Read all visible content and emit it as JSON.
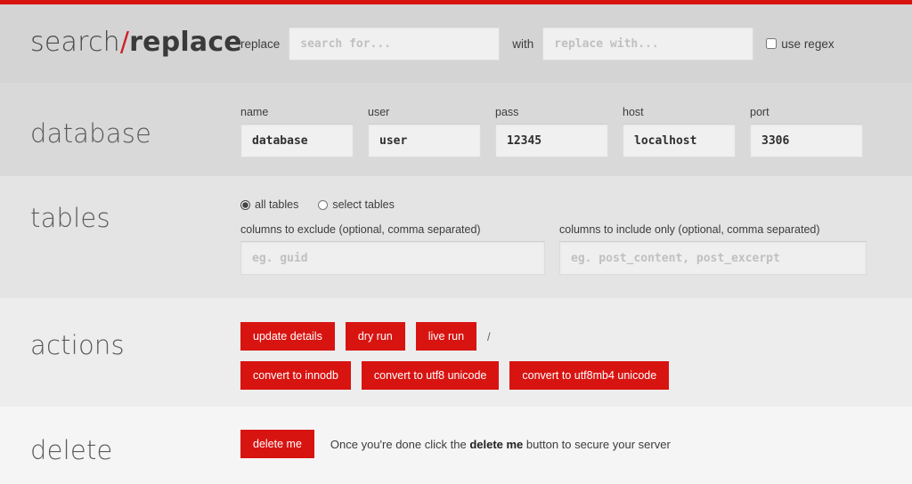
{
  "theme": {
    "accent_red": "#d81411",
    "topbar_red": "#d81411",
    "text_dark": "#3c3c3c"
  },
  "header": {
    "title_part1": "search",
    "title_slash": "/",
    "title_part2": "replace",
    "replace_label": "replace",
    "search_for_placeholder": "search for...",
    "search_for_value": "",
    "with_label": "with",
    "replace_with_placeholder": "replace with...",
    "replace_with_value": "",
    "use_regex_label": "use regex",
    "use_regex_checked": false
  },
  "database": {
    "title": "database",
    "fields": [
      {
        "label": "name",
        "value": "database"
      },
      {
        "label": "user",
        "value": "user"
      },
      {
        "label": "pass",
        "value": "12345"
      },
      {
        "label": "host",
        "value": "localhost"
      },
      {
        "label": "port",
        "value": "3306"
      }
    ]
  },
  "tables": {
    "title": "tables",
    "radios": [
      {
        "label": "all tables",
        "selected": true
      },
      {
        "label": "select tables",
        "selected": false
      }
    ],
    "exclude_label": "columns to exclude (optional, comma separated)",
    "exclude_placeholder": "eg. guid",
    "exclude_value": "",
    "include_label": "columns to include only (optional, comma separated)",
    "include_placeholder": "eg. post_content, post_excerpt",
    "include_value": ""
  },
  "actions": {
    "title": "actions",
    "row1": [
      {
        "label": "update details"
      },
      {
        "label": "dry run"
      },
      {
        "label": "live run"
      }
    ],
    "separator": "/",
    "row2": [
      {
        "label": "convert to innodb"
      },
      {
        "label": "convert to utf8 unicode"
      },
      {
        "label": "convert to utf8mb4 unicode"
      }
    ]
  },
  "delete": {
    "title": "delete",
    "button_label": "delete me",
    "note_before": "Once you're done click the ",
    "note_bold": "delete me",
    "note_after": " button to secure your server"
  }
}
